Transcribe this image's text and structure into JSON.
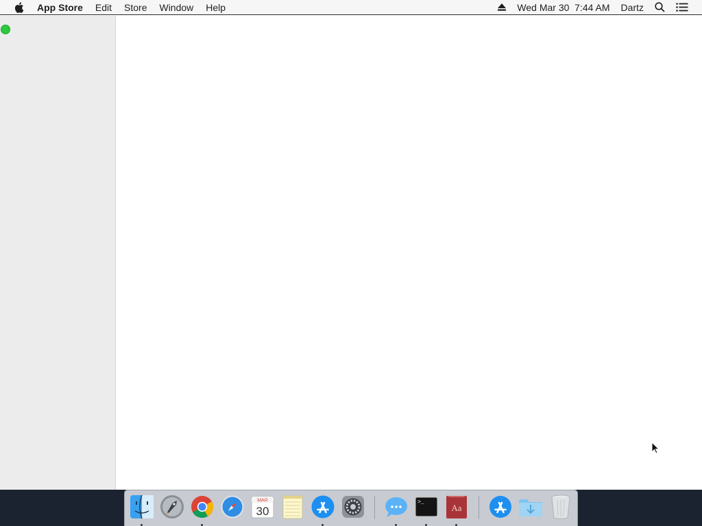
{
  "menubar": {
    "app_name": "App Store",
    "menus": [
      "Edit",
      "Store",
      "Window",
      "Help"
    ],
    "datetime": "Wed Mar 30  7:44 AM",
    "user": "Dartz",
    "status_icons": [
      "eject-icon",
      "spotlight-search-icon",
      "notification-center-icon"
    ]
  },
  "window": {
    "traffic_light_color": "#2bc840"
  },
  "dock": {
    "calendar": {
      "month": "MAR",
      "day": "30"
    },
    "dictionary_label": "Aa",
    "terminal_prompt": ">_",
    "items": [
      {
        "name": "Finder",
        "icon": "finder-icon",
        "running": true
      },
      {
        "name": "Launchpad",
        "icon": "launchpad-icon",
        "running": false
      },
      {
        "name": "Google Chrome",
        "icon": "chrome-icon",
        "running": true
      },
      {
        "name": "Safari",
        "icon": "safari-icon",
        "running": false
      },
      {
        "name": "Calendar",
        "icon": "calendar-icon",
        "running": false
      },
      {
        "name": "Notes",
        "icon": "notes-icon",
        "running": false
      },
      {
        "name": "App Store",
        "icon": "app-store-icon",
        "running": true
      },
      {
        "name": "System Preferences",
        "icon": "system-preferences-icon",
        "running": false
      },
      {
        "name": "Messages",
        "icon": "messages-icon",
        "running": true
      },
      {
        "name": "Terminal",
        "icon": "terminal-icon",
        "running": true
      },
      {
        "name": "Dictionary",
        "icon": "dictionary-icon",
        "running": true
      },
      {
        "name": "Applications",
        "icon": "applications-folder-icon",
        "running": false
      },
      {
        "name": "Downloads",
        "icon": "downloads-folder-icon",
        "running": false
      },
      {
        "name": "Trash",
        "icon": "trash-icon",
        "running": false
      }
    ]
  }
}
